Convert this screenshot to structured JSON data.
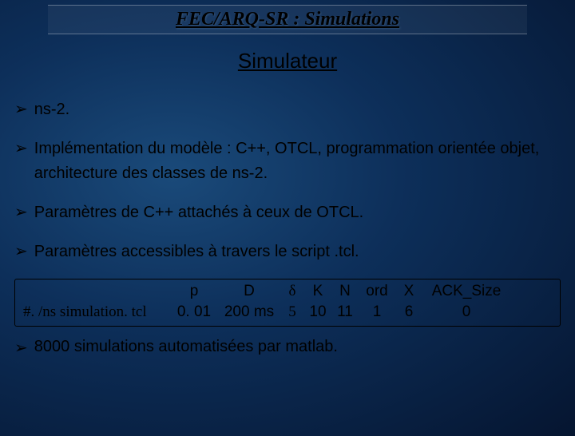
{
  "title": "FEC/ARQ-SR : Simulations",
  "subtitle": "Simulateur",
  "bullets": [
    "ns-2.",
    "Implémentation du modèle : C++, OTCL, programmation orientée objet, architecture des classes de ns-2.",
    "Paramètres de C++ attachés à ceux de OTCL.",
    "Paramètres accessibles à travers le script .tcl."
  ],
  "table": {
    "headers": [
      "",
      "p",
      "D",
      "δ",
      "K",
      "N",
      "ord",
      "X",
      "ACK_Size"
    ],
    "row": [
      "#. /ns simulation. tcl",
      "0. 01",
      "200 ms",
      "5",
      "10",
      "11",
      "1",
      "6",
      "0"
    ]
  },
  "last_bullet": "8000 simulations automatisées par matlab.",
  "bullet_glyph": "➢"
}
